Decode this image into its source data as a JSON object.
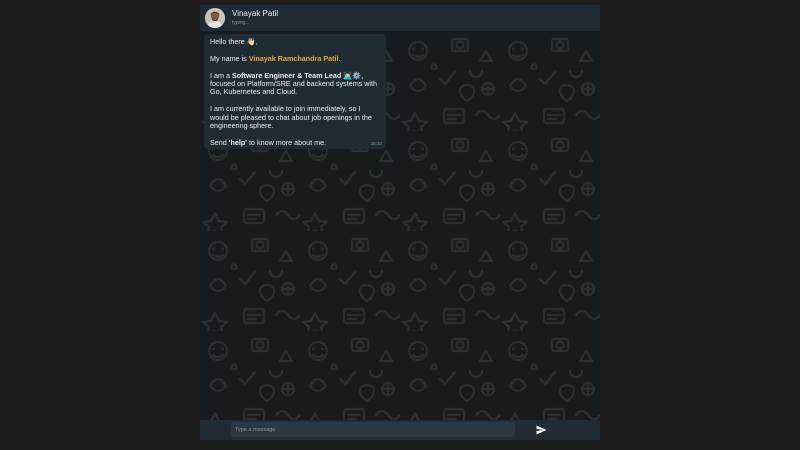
{
  "header": {
    "contact_name": "Vinayak Patil",
    "status": "typing..."
  },
  "message": {
    "greeting": "Hello there 👋🏻,",
    "name_prefix": "My name is ",
    "full_name": "Vinayak Ramchandra Patil",
    "name_suffix": ".",
    "role_prefix": "I am a ",
    "role": "Software Engineer & Team Lead 👨🏻‍💻⚙️",
    "role_suffix": ", focused on Platform/SRE and backend systems with Go, Kubernetes and Cloud.",
    "availability": "I am currently available to join immediately, so I would be pleased to chat about job openings in the engineering sphere.",
    "help_prefix": "Send ",
    "help_keyword": "'help'",
    "help_suffix": " to know more about me.",
    "time": "16:22"
  },
  "footer": {
    "input_placeholder": "Type a message"
  },
  "colors": {
    "background": "#1c1c1c",
    "header": "#1f2c34",
    "bubble": "#1f2c34",
    "highlight": "#e8a62e",
    "text": "#e9edef",
    "muted": "#8696a0"
  },
  "icons": {
    "send": "send-icon",
    "avatar": "avatar"
  }
}
